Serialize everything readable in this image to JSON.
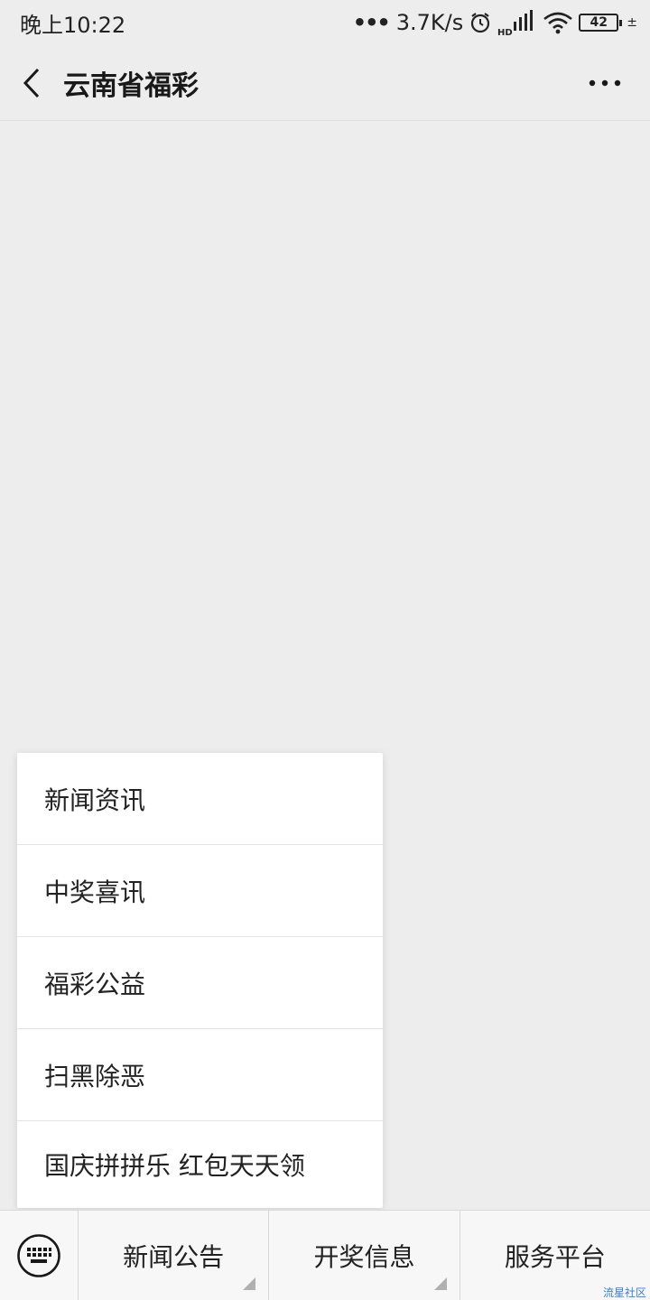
{
  "status_bar": {
    "time": "晚上10:22",
    "network_speed": "3.7K/s",
    "hd_label": "HD",
    "battery_level": "42",
    "charge_symbol": "±"
  },
  "nav": {
    "title": "云南省福彩"
  },
  "popup_menu": {
    "items": [
      {
        "label": "新闻资讯"
      },
      {
        "label": "中奖喜讯"
      },
      {
        "label": "福彩公益"
      },
      {
        "label": "扫黑除恶"
      },
      {
        "label": "国庆拼拼乐  红包天天领"
      }
    ]
  },
  "bottom_menu": {
    "tabs": [
      {
        "label": "新闻公告"
      },
      {
        "label": "开奖信息"
      },
      {
        "label": "服务平台"
      }
    ]
  },
  "watermark": "流星社区",
  "colors": {
    "background": "#ededed",
    "surface": "#ffffff",
    "text": "#191919"
  }
}
